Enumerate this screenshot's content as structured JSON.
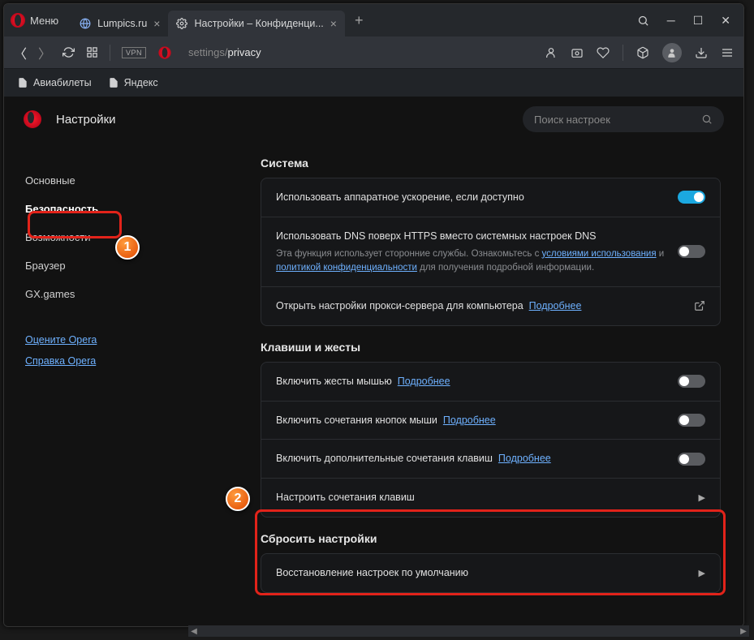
{
  "titlebar": {
    "menu_label": "Меню",
    "tabs": [
      {
        "label": "Lumpics.ru"
      },
      {
        "label": "Настройки – Конфиденци..."
      }
    ]
  },
  "navbar": {
    "vpn_label": "VPN",
    "url_prefix": "settings/",
    "url_path": "privacy"
  },
  "bookmarks_bar": {
    "items": [
      "Авиабилеты",
      "Яндекс"
    ]
  },
  "settings": {
    "title": "Настройки",
    "search_placeholder": "Поиск настроек"
  },
  "sidebar": {
    "items": [
      "Основные",
      "Безопасность",
      "Возможности",
      "Браузер",
      "GX.games"
    ],
    "links": [
      "Оцените Opera",
      "Справка Opera"
    ]
  },
  "sections": {
    "system": {
      "title": "Система",
      "hw_accel": "Использовать аппаратное ускорение, если доступно",
      "dns_https": "Использовать DNS поверх HTTPS вместо системных настроек DNS",
      "dns_sub_1": "Эта функция использует сторонние службы. Ознакомьтесь с ",
      "dns_link_1": "условиями использования",
      "dns_sub_2": " и ",
      "dns_link_2": "политикой конфиденциальности",
      "dns_sub_3": " для получения подробной информации.",
      "proxy": "Открыть настройки прокси-сервера для компьютера",
      "learn_more": "Подробнее"
    },
    "keys": {
      "title": "Клавиши и жесты",
      "mouse_gestures": "Включить жесты мышью",
      "rocker": "Включить сочетания кнопок мыши",
      "extra_shortcuts": "Включить дополнительные сочетания клавиш",
      "configure": "Настроить сочетания клавиш",
      "learn_more": "Подробнее"
    },
    "reset": {
      "title": "Сбросить настройки",
      "restore": "Восстановление настроек по умолчанию"
    }
  }
}
